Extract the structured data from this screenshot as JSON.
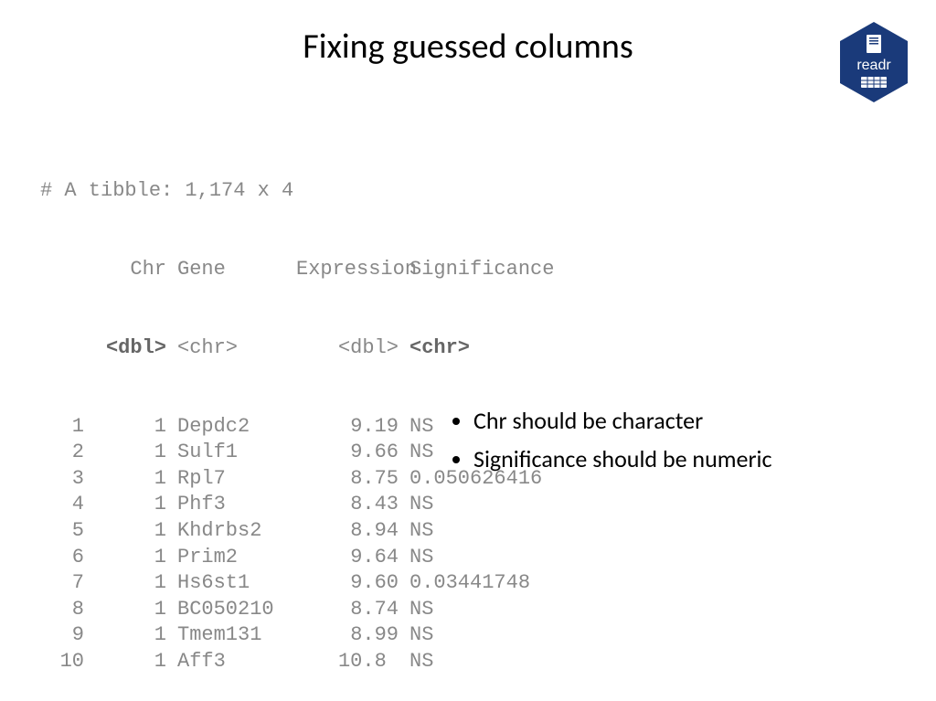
{
  "title": "Fixing guessed columns",
  "logo": {
    "label": "readr"
  },
  "tibble": {
    "header": "# A tibble: 1,174 x 4",
    "columns": {
      "idx": "",
      "chr": "Chr",
      "gene": "Gene",
      "expr": "Expression",
      "sig": "Significance"
    },
    "types": {
      "chr": "<dbl>",
      "gene": "<chr>",
      "expr": "<dbl>",
      "sig": "<chr>"
    },
    "rows": [
      {
        "idx": " 1",
        "chr": "1",
        "gene": "Depdc2",
        "expr": "9.19",
        "sig": "NS"
      },
      {
        "idx": " 2",
        "chr": "1",
        "gene": "Sulf1",
        "expr": "9.66",
        "sig": "NS"
      },
      {
        "idx": " 3",
        "chr": "1",
        "gene": "Rpl7",
        "expr": "8.75",
        "sig": "0.050626416"
      },
      {
        "idx": " 4",
        "chr": "1",
        "gene": "Phf3",
        "expr": "8.43",
        "sig": "NS"
      },
      {
        "idx": " 5",
        "chr": "1",
        "gene": "Khdrbs2",
        "expr": "8.94",
        "sig": "NS"
      },
      {
        "idx": " 6",
        "chr": "1",
        "gene": "Prim2",
        "expr": "9.64",
        "sig": "NS"
      },
      {
        "idx": " 7",
        "chr": "1",
        "gene": "Hs6st1",
        "expr": "9.60",
        "sig": "0.03441748"
      },
      {
        "idx": " 8",
        "chr": "1",
        "gene": "BC050210",
        "expr": "8.74",
        "sig": "NS"
      },
      {
        "idx": " 9",
        "chr": "1",
        "gene": "Tmem131",
        "expr": "8.99",
        "sig": "NS"
      },
      {
        "idx": "10",
        "chr": "1",
        "gene": "Aff3",
        "expr": "10.8 ",
        "sig": "NS"
      }
    ]
  },
  "notes": [
    "Chr should be character",
    "Significance should be numeric"
  ]
}
